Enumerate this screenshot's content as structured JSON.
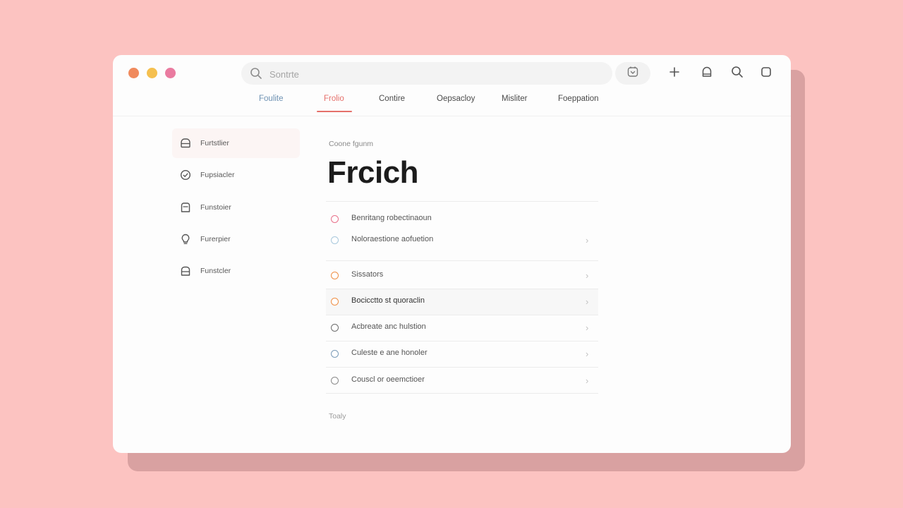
{
  "window": {
    "traffic_lights": [
      {
        "name": "close",
        "color": "#f08a5d"
      },
      {
        "name": "minimize",
        "color": "#f5c04f"
      },
      {
        "name": "maximize",
        "color": "#ea7ba0"
      }
    ]
  },
  "toolbar": {
    "search_placeholder": "Sontrte",
    "icons": [
      "calendar-icon",
      "plus-icon",
      "bell-icon",
      "search-icon",
      "square-icon"
    ]
  },
  "tabs": [
    {
      "label": "Foulite"
    },
    {
      "label": "Frolio",
      "active": true
    },
    {
      "label": "Contire"
    },
    {
      "label": "Oepsacloy"
    },
    {
      "label": "Misliter"
    },
    {
      "label": "Foeppation"
    }
  ],
  "sidebar": {
    "items": [
      {
        "label": "Furtstlier",
        "icon": "inbox-icon",
        "active": true
      },
      {
        "label": "Fupsiacler",
        "icon": "check-circle-icon"
      },
      {
        "label": "Funstoier",
        "icon": "folder-icon"
      },
      {
        "label": "Furerpier",
        "icon": "lightbulb-icon"
      },
      {
        "label": "Funstcler",
        "icon": "archive-icon"
      }
    ]
  },
  "main": {
    "subtitle": "Coone fgunm",
    "title": "Frcich",
    "rows": [
      {
        "label": "Benritang robectinaoun",
        "color": "#e8708a",
        "chevron": false
      },
      {
        "label": "Noloraestione aofuetion",
        "color": "#a8c8dc",
        "chevron": true
      },
      {
        "label": "Sissators",
        "color": "#ef8f45",
        "chevron": true
      },
      {
        "label": "Bocicctto st quoraclin",
        "color": "#ef8f45",
        "chevron": true,
        "highlighted": true
      },
      {
        "label": "Acbreate anc hulstion",
        "color": "#6d6d6d",
        "chevron": true
      },
      {
        "label": "Culeste e ane honoler",
        "color": "#7a9bb8",
        "chevron": true
      },
      {
        "label": "Couscl or oeemctioer",
        "color": "#8a8a8a",
        "chevron": true
      }
    ],
    "footer": "Toaly"
  }
}
